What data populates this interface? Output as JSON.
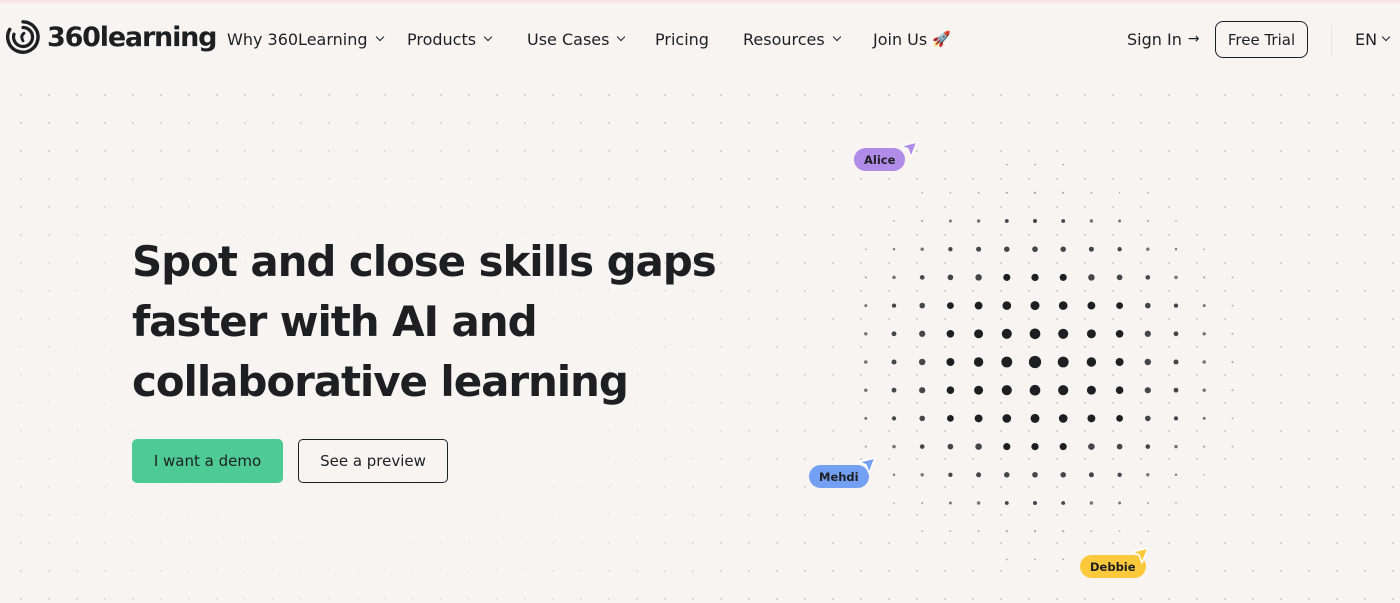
{
  "brand": {
    "name": "360learning",
    "logo_icon": "360learning-circular-logo-icon"
  },
  "nav": {
    "items": [
      {
        "label": "Why 360Learning",
        "has_dropdown": true
      },
      {
        "label": "Products",
        "has_dropdown": true
      },
      {
        "label": "Use Cases",
        "has_dropdown": true
      },
      {
        "label": "Pricing",
        "has_dropdown": false
      },
      {
        "label": "Resources",
        "has_dropdown": true
      },
      {
        "label": "Join Us",
        "has_dropdown": false,
        "emoji": "🚀"
      }
    ],
    "sign_in": {
      "label": "Sign In",
      "icon": "→"
    },
    "free_trial": {
      "label": "Free Trial"
    },
    "language": {
      "label": "EN",
      "has_dropdown": true
    }
  },
  "hero": {
    "headline_lines": [
      "Spot and close skills gaps",
      "faster with AI and",
      "collaborative learning"
    ],
    "primary_cta": "I want a demo",
    "secondary_cta": "See a preview"
  },
  "cursors": [
    {
      "name": "Alice",
      "color": "#b18be8"
    },
    {
      "name": "Mehdi",
      "color": "#74a0f4"
    },
    {
      "name": "Debbie",
      "color": "#fcc93d"
    }
  ],
  "colors": {
    "background": "#f8f4f1",
    "text": "#1e1f23",
    "primary_cta": "#4ecb94",
    "dot": "#1e1f23"
  }
}
